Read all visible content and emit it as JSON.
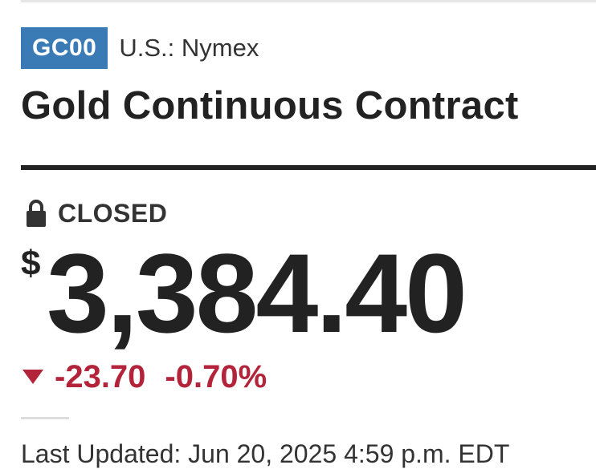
{
  "quote": {
    "ticker": "GC00",
    "exchange": "U.S.: Nymex",
    "title": "Gold Continuous Contract",
    "status": "CLOSED",
    "status_icon": "lock-icon",
    "currency_symbol": "$",
    "price": "3,384.40",
    "change": "-23.70",
    "change_percent": "-0.70%",
    "change_direction": "down",
    "last_updated": "Last Updated: Jun 20, 2025 4:59 p.m. EDT"
  },
  "colors": {
    "ticker_badge": "#3a7ab5",
    "negative": "#b3243a",
    "text": "#222222"
  }
}
